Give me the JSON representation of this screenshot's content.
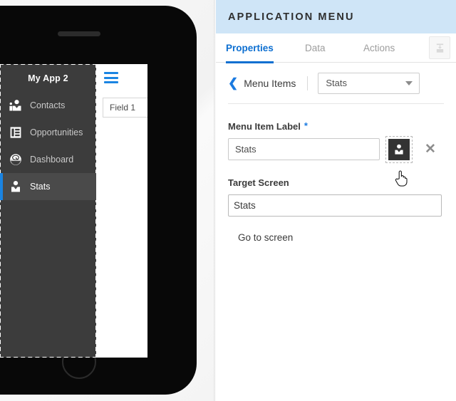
{
  "preview": {
    "app_title": "My App 2",
    "hamburger_icon": "hamburger-menu-icon",
    "field_box_label": "Field 1",
    "menu_items": [
      {
        "label": "Contacts",
        "icon": "contacts-people-icon",
        "active": false
      },
      {
        "label": "Opportunities",
        "icon": "clipboard-list-icon",
        "active": false
      },
      {
        "label": "Dashboard",
        "icon": "dashboard-gauge-icon",
        "active": false
      },
      {
        "label": "Stats",
        "icon": "person-avatar-icon",
        "active": true
      }
    ],
    "accent_color": "#1a84e2",
    "drawer_bg": "#3c3c3c",
    "drawer_active_bg": "#4a4a4a"
  },
  "panel": {
    "title": "APPLICATION MENU",
    "titlebar_color": "#cfe5f7",
    "accent_color": "#0d6fd1",
    "tabs": [
      {
        "label": "Properties",
        "active": true
      },
      {
        "label": "Data",
        "active": false
      },
      {
        "label": "Actions",
        "active": false
      }
    ],
    "tab_icon": "collapse-panel-icon",
    "breadcrumb": {
      "back_icon": "chevron-left-icon",
      "label": "Menu Items",
      "select_value": "Stats",
      "select_caret_icon": "caret-down-icon"
    },
    "menu_item_label": {
      "label": "Menu Item Label",
      "required_marker": "*",
      "value": "Stats",
      "icon_picker_icon": "person-avatar-icon",
      "clear_icon": "close-x-icon"
    },
    "target_screen": {
      "label": "Target Screen",
      "value": "Stats"
    },
    "go_to_screen_label": "Go to screen"
  },
  "cursor": {
    "icon": "pointing-hand-cursor"
  }
}
